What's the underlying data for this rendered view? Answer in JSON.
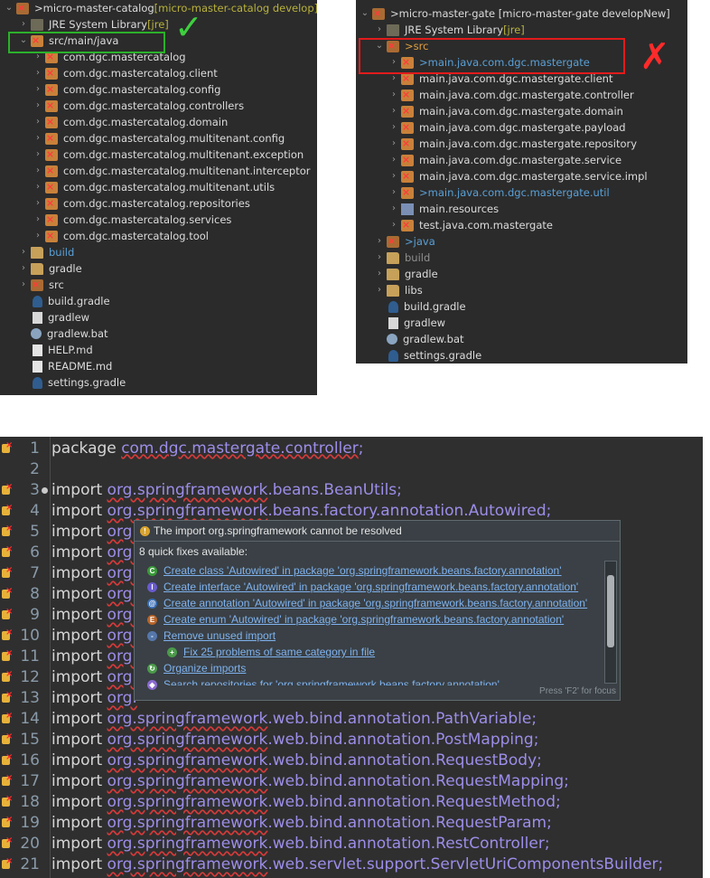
{
  "left_tree": [
    {
      "label": "micro-master-catalog",
      "decor": " [micro-master-catalog develop]",
      "icon": "proj",
      "arrow": "v",
      "indent": 0,
      "prefix": "> "
    },
    {
      "label": "JRE System Library",
      "decor": " [jre]",
      "icon": "lib",
      "arrow": ">",
      "indent": 1
    },
    {
      "label": "src/main/java",
      "decor": "",
      "icon": "pkg",
      "arrow": "v",
      "indent": 1
    },
    {
      "label": "com.dgc.mastercatalog",
      "icon": "pkg",
      "arrow": ">",
      "indent": 2
    },
    {
      "label": "com.dgc.mastercatalog.client",
      "icon": "pkg",
      "arrow": ">",
      "indent": 2
    },
    {
      "label": "com.dgc.mastercatalog.config",
      "icon": "pkg",
      "arrow": ">",
      "indent": 2
    },
    {
      "label": "com.dgc.mastercatalog.controllers",
      "icon": "pkg",
      "arrow": ">",
      "indent": 2
    },
    {
      "label": "com.dgc.mastercatalog.domain",
      "icon": "pkg",
      "arrow": ">",
      "indent": 2
    },
    {
      "label": "com.dgc.mastercatalog.multitenant.config",
      "icon": "pkg",
      "arrow": ">",
      "indent": 2
    },
    {
      "label": "com.dgc.mastercatalog.multitenant.exception",
      "icon": "pkg",
      "arrow": ">",
      "indent": 2
    },
    {
      "label": "com.dgc.mastercatalog.multitenant.interceptor",
      "icon": "pkg",
      "arrow": ">",
      "indent": 2
    },
    {
      "label": "com.dgc.mastercatalog.multitenant.utils",
      "icon": "pkg",
      "arrow": ">",
      "indent": 2
    },
    {
      "label": "com.dgc.mastercatalog.repositories",
      "icon": "pkg",
      "arrow": ">",
      "indent": 2
    },
    {
      "label": "com.dgc.mastercatalog.services",
      "icon": "pkg",
      "arrow": ">",
      "indent": 2
    },
    {
      "label": "com.dgc.mastercatalog.tool",
      "icon": "pkg",
      "arrow": ">",
      "indent": 2
    },
    {
      "label": "build",
      "icon": "folder",
      "arrow": ">",
      "indent": 1,
      "color": "#5aa0d6"
    },
    {
      "label": "gradle",
      "icon": "folder",
      "arrow": ">",
      "indent": 1
    },
    {
      "label": "src",
      "icon": "proj",
      "arrow": ">",
      "indent": 1
    },
    {
      "label": "build.gradle",
      "icon": "gfile",
      "arrow": "",
      "indent": 1
    },
    {
      "label": "gradlew",
      "icon": "file",
      "arrow": "",
      "indent": 1
    },
    {
      "label": "gradlew.bat",
      "icon": "gear",
      "arrow": "",
      "indent": 1
    },
    {
      "label": "HELP.md",
      "icon": "md",
      "arrow": "",
      "indent": 1
    },
    {
      "label": "README.md",
      "icon": "md",
      "arrow": "",
      "indent": 1
    },
    {
      "label": "settings.gradle",
      "icon": "gfile",
      "arrow": "",
      "indent": 1
    }
  ],
  "right_tree": [
    {
      "label": "micro-master-gate [micro-master-gate developNew]",
      "icon": "proj",
      "arrow": "v",
      "indent": 0,
      "prefix": "> "
    },
    {
      "label": "JRE System Library",
      "decor": " [jre]",
      "icon": "lib",
      "arrow": ">",
      "indent": 1
    },
    {
      "label": "src",
      "icon": "proj",
      "arrow": "v",
      "indent": 1,
      "prefix": "> ",
      "color": "#e0a040"
    },
    {
      "label": "main.java.com.dgc.mastergate",
      "icon": "pkg",
      "arrow": ">",
      "indent": 2,
      "prefix": "> ",
      "color": "#5aa0d6"
    },
    {
      "label": "main.java.com.dgc.mastergate.client",
      "icon": "pkg",
      "arrow": ">",
      "indent": 2
    },
    {
      "label": "main.java.com.dgc.mastergate.controller",
      "icon": "pkg",
      "arrow": ">",
      "indent": 2
    },
    {
      "label": "main.java.com.dgc.mastergate.domain",
      "icon": "pkg",
      "arrow": ">",
      "indent": 2
    },
    {
      "label": "main.java.com.dgc.mastergate.payload",
      "icon": "pkg",
      "arrow": ">",
      "indent": 2
    },
    {
      "label": "main.java.com.dgc.mastergate.repository",
      "icon": "pkg",
      "arrow": ">",
      "indent": 2
    },
    {
      "label": "main.java.com.dgc.mastergate.service",
      "icon": "pkg",
      "arrow": ">",
      "indent": 2
    },
    {
      "label": "main.java.com.dgc.mastergate.service.impl",
      "icon": "pkg",
      "arrow": ">",
      "indent": 2
    },
    {
      "label": "main.java.com.dgc.mastergate.util",
      "icon": "pkg",
      "arrow": ">",
      "indent": 2,
      "prefix": "> ",
      "color": "#5aa0d6"
    },
    {
      "label": "main.resources",
      "icon": "res",
      "arrow": ">",
      "indent": 2
    },
    {
      "label": "test.java.com.mastergate",
      "icon": "pkg",
      "arrow": ">",
      "indent": 2
    },
    {
      "label": "java",
      "icon": "proj",
      "arrow": ">",
      "indent": 1,
      "prefix": "> ",
      "color": "#5aa0d6"
    },
    {
      "label": "build",
      "icon": "folder",
      "arrow": ">",
      "indent": 1,
      "color": "#8f8f8f"
    },
    {
      "label": "gradle",
      "icon": "folder",
      "arrow": ">",
      "indent": 1
    },
    {
      "label": "libs",
      "icon": "folder",
      "arrow": ">",
      "indent": 1
    },
    {
      "label": "build.gradle",
      "icon": "gfile",
      "arrow": "",
      "indent": 1
    },
    {
      "label": "gradlew",
      "icon": "file",
      "arrow": "",
      "indent": 1
    },
    {
      "label": "gradlew.bat",
      "icon": "gear",
      "arrow": "",
      "indent": 1
    },
    {
      "label": "settings.gradle",
      "icon": "gfile",
      "arrow": "",
      "indent": 1
    }
  ],
  "marks": {
    "check": "✓",
    "cross": "✗"
  },
  "editor": {
    "lines": [
      {
        "n": "1",
        "kw": "package",
        "pkg": "com.dgc.mastergate.controller",
        "rest": ";",
        "plain": true
      },
      {
        "n": "2",
        "kw": "",
        "pkg": "",
        "rest": ""
      },
      {
        "n": "3",
        "kw": "import",
        "pkg": "org.springframework",
        "rest": ".beans.BeanUtils;"
      },
      {
        "n": "4",
        "kw": "import",
        "pkg": "org.springframework",
        "rest": ".beans.factory.annotation.Autowired;"
      },
      {
        "n": "5",
        "kw": "import",
        "pkg": "org.",
        "rest": ""
      },
      {
        "n": "6",
        "kw": "import",
        "pkg": "org.",
        "rest": ""
      },
      {
        "n": "7",
        "kw": "import",
        "pkg": "org.",
        "rest": ""
      },
      {
        "n": "8",
        "kw": "import",
        "pkg": "org.",
        "rest": ""
      },
      {
        "n": "9",
        "kw": "import",
        "pkg": "org.",
        "rest": ""
      },
      {
        "n": "10",
        "kw": "import",
        "pkg": "org.",
        "rest": ""
      },
      {
        "n": "11",
        "kw": "import",
        "pkg": "org.",
        "rest": ""
      },
      {
        "n": "12",
        "kw": "import",
        "pkg": "org.",
        "rest": ""
      },
      {
        "n": "13",
        "kw": "import",
        "pkg": "org.",
        "rest": ""
      },
      {
        "n": "14",
        "kw": "import",
        "pkg": "org.springframework",
        "rest": ".web.bind.annotation.PathVariable;"
      },
      {
        "n": "15",
        "kw": "import",
        "pkg": "org.springframework",
        "rest": ".web.bind.annotation.PostMapping;"
      },
      {
        "n": "16",
        "kw": "import",
        "pkg": "org.springframework",
        "rest": ".web.bind.annotation.RequestBody;"
      },
      {
        "n": "17",
        "kw": "import",
        "pkg": "org.springframework",
        "rest": ".web.bind.annotation.RequestMapping;"
      },
      {
        "n": "18",
        "kw": "import",
        "pkg": "org.springframework",
        "rest": ".web.bind.annotation.RequestMethod;"
      },
      {
        "n": "19",
        "kw": "import",
        "pkg": "org.springframework",
        "rest": ".web.bind.annotation.RequestParam;"
      },
      {
        "n": "20",
        "kw": "import",
        "pkg": "org.springframework",
        "rest": ".web.bind.annotation.RestController;"
      },
      {
        "n": "21",
        "kw": "import",
        "pkg": "org.springframework",
        "rest": ".web.servlet.support.ServletUriComponentsBuilder;"
      }
    ]
  },
  "popup": {
    "title": "The import org.springframework cannot be resolved",
    "subtitle": "8 quick fixes available:",
    "fixes": [
      {
        "icon": "C",
        "color": "#3a9a3a",
        "label": "Create class 'Autowired' in package 'org.springframework.beans.factory.annotation'",
        "indent": 0
      },
      {
        "icon": "I",
        "color": "#6a5acd",
        "label": "Create interface 'Autowired' in package 'org.springframework.beans.factory.annotation'",
        "indent": 0
      },
      {
        "icon": "@",
        "color": "#3b6fb6",
        "label": "Create annotation 'Autowired' in package 'org.springframework.beans.factory.annotation'",
        "indent": 0
      },
      {
        "icon": "E",
        "color": "#b9652a",
        "label": "Create enum 'Autowired' in package 'org.springframework.beans.factory.annotation'",
        "indent": 0
      },
      {
        "icon": "-",
        "color": "#5577aa",
        "label": "Remove unused import",
        "indent": 0
      },
      {
        "icon": "+",
        "color": "#4a9a4a",
        "label": "Fix 25 problems of same category in file",
        "indent": 1
      },
      {
        "icon": "↻",
        "color": "#4a9a4a",
        "label": "Organize imports",
        "indent": 0
      },
      {
        "icon": "◆",
        "color": "#8a6ad0",
        "label": "Search repositories for 'org.springframework.beans.factory.annotation'",
        "indent": 0
      }
    ],
    "footer": "Press 'F2' for focus"
  }
}
